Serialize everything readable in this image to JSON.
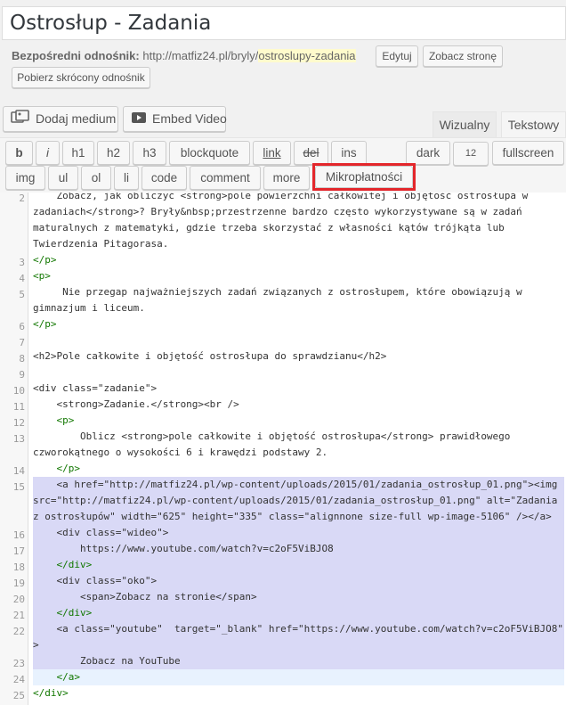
{
  "post": {
    "title": "Ostrosłup - Zadania",
    "permalink_label": "Bezpośredni odnośnik:",
    "permalink_base": "http://matfiz24.pl/bryly/",
    "permalink_slug": "ostroslupy-zadania",
    "edit_label": "Edytuj",
    "view_label": "Zobacz stronę",
    "shortlink_label": "Pobierz skrócony odnośnik"
  },
  "media": {
    "add_media_label": "Dodaj medium",
    "embed_video_label": "Embed Video"
  },
  "tabs": {
    "visual": "Wizualny",
    "text": "Tekstowy"
  },
  "quicktags": {
    "row1": [
      "b",
      "i",
      "h1",
      "h2",
      "h3",
      "blockquote",
      "link",
      "del",
      "ins"
    ],
    "theme": "dark",
    "font_size": "12",
    "fullscreen": "fullscreen",
    "row2": [
      "img",
      "ul",
      "ol",
      "li",
      "code",
      "comment",
      "more",
      "Mikropłatności"
    ]
  },
  "editor": {
    "line_numbers": [
      "2",
      "3",
      "4",
      "5",
      "6",
      "7",
      "8",
      "9",
      "10",
      "11",
      "12",
      "13",
      "14",
      "15",
      "16",
      "17",
      "18",
      "19",
      "20",
      "21",
      "22",
      "23",
      "24",
      "25"
    ],
    "selected_lines": [
      "15",
      "16",
      "17",
      "18",
      "19",
      "20",
      "21",
      "22",
      "23",
      "24"
    ],
    "cursor_line": "24",
    "code": {
      "l2a": "    Zobacz, jak obliczyć <strong>pole powierzchni całkowitej i objętość ostrosłupa w",
      "l2b": "zadaniach</strong>? Bryły&nbsp;przestrzenne bardzo często wykorzystywane są w zadań",
      "l2c": "maturalnych z matematyki, gdzie trzeba skorzystać z własności kątów trójkąta lub",
      "l2d": "Twierdzenia Pitagorasa.",
      "l3": "</p>",
      "l4": "<p>",
      "l5a": "     Nie przegap najważniejszych zadań związanych z ostrosłupem, które obowiązują w",
      "l5b": "gimnazjum i liceum.",
      "l6": "</p>",
      "l7": "",
      "l8": "<h2>Pole całkowite i objętość ostrosłupa do sprawdzianu</h2>",
      "l9": "",
      "l10": "<div class=\"zadanie\">",
      "l11": "    <strong>Zadanie.</strong><br />",
      "l12": "    <p>",
      "l13a": "        Oblicz <strong>pole całkowite i objętość ostrosłupa</strong> prawidłowego",
      "l13b": "czworokątnego o wysokości 6 i krawędzi podstawy 2.",
      "l14": "    </p>",
      "l15a": "    <a href=\"http://matfiz24.pl/wp-content/uploads/2015/01/zadania_ostrosłup_01.png\"><img",
      "l15b": "src=\"http://matfiz24.pl/wp-content/uploads/2015/01/zadania_ostrosłup_01.png\" alt=\"Zadania",
      "l15c": "z ostrosłupów\" width=\"625\" height=\"335\" class=\"alignnone size-full wp-image-5106\" /></a>",
      "l16": "    <div class=\"wideo\">",
      "l17": "        https://www.youtube.com/watch?v=c2oF5ViBJO8",
      "l18": "    </div>",
      "l19": "    <div class=\"oko\">",
      "l20": "        <span>Zobacz na stronie</span>",
      "l21": "    </div>",
      "l22a": "    <a class=\"youtube\"  target=\"_blank\" href=\"https://www.youtube.com/watch?v=c2oF5ViBJO8\"",
      "l22b": ">",
      "l23": "        Zobacz na YouTube",
      "l24": "    </a>",
      "l25": "</div>"
    }
  }
}
